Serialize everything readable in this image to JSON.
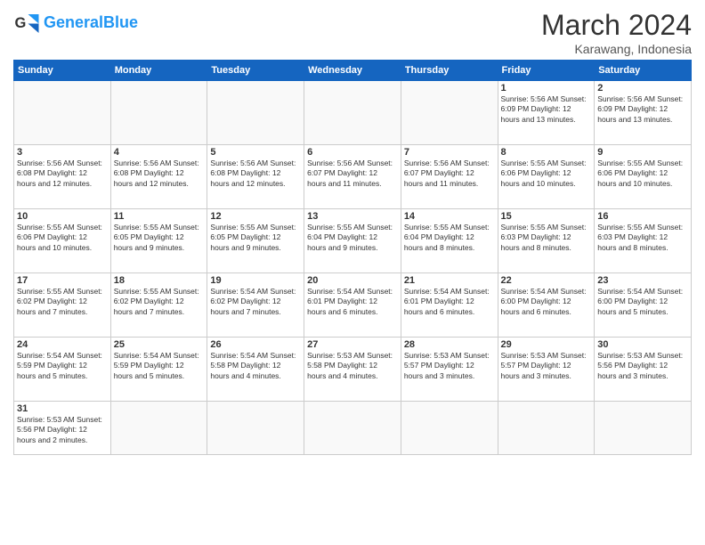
{
  "header": {
    "logo_general": "General",
    "logo_blue": "Blue",
    "title": "March 2024",
    "subtitle": "Karawang, Indonesia"
  },
  "days_of_week": [
    "Sunday",
    "Monday",
    "Tuesday",
    "Wednesday",
    "Thursday",
    "Friday",
    "Saturday"
  ],
  "weeks": [
    [
      {
        "day": "",
        "info": ""
      },
      {
        "day": "",
        "info": ""
      },
      {
        "day": "",
        "info": ""
      },
      {
        "day": "",
        "info": ""
      },
      {
        "day": "",
        "info": ""
      },
      {
        "day": "1",
        "info": "Sunrise: 5:56 AM\nSunset: 6:09 PM\nDaylight: 12 hours\nand 13 minutes."
      },
      {
        "day": "2",
        "info": "Sunrise: 5:56 AM\nSunset: 6:09 PM\nDaylight: 12 hours\nand 13 minutes."
      }
    ],
    [
      {
        "day": "3",
        "info": "Sunrise: 5:56 AM\nSunset: 6:08 PM\nDaylight: 12 hours\nand 12 minutes."
      },
      {
        "day": "4",
        "info": "Sunrise: 5:56 AM\nSunset: 6:08 PM\nDaylight: 12 hours\nand 12 minutes."
      },
      {
        "day": "5",
        "info": "Sunrise: 5:56 AM\nSunset: 6:08 PM\nDaylight: 12 hours\nand 12 minutes."
      },
      {
        "day": "6",
        "info": "Sunrise: 5:56 AM\nSunset: 6:07 PM\nDaylight: 12 hours\nand 11 minutes."
      },
      {
        "day": "7",
        "info": "Sunrise: 5:56 AM\nSunset: 6:07 PM\nDaylight: 12 hours\nand 11 minutes."
      },
      {
        "day": "8",
        "info": "Sunrise: 5:55 AM\nSunset: 6:06 PM\nDaylight: 12 hours\nand 10 minutes."
      },
      {
        "day": "9",
        "info": "Sunrise: 5:55 AM\nSunset: 6:06 PM\nDaylight: 12 hours\nand 10 minutes."
      }
    ],
    [
      {
        "day": "10",
        "info": "Sunrise: 5:55 AM\nSunset: 6:06 PM\nDaylight: 12 hours\nand 10 minutes."
      },
      {
        "day": "11",
        "info": "Sunrise: 5:55 AM\nSunset: 6:05 PM\nDaylight: 12 hours\nand 9 minutes."
      },
      {
        "day": "12",
        "info": "Sunrise: 5:55 AM\nSunset: 6:05 PM\nDaylight: 12 hours\nand 9 minutes."
      },
      {
        "day": "13",
        "info": "Sunrise: 5:55 AM\nSunset: 6:04 PM\nDaylight: 12 hours\nand 9 minutes."
      },
      {
        "day": "14",
        "info": "Sunrise: 5:55 AM\nSunset: 6:04 PM\nDaylight: 12 hours\nand 8 minutes."
      },
      {
        "day": "15",
        "info": "Sunrise: 5:55 AM\nSunset: 6:03 PM\nDaylight: 12 hours\nand 8 minutes."
      },
      {
        "day": "16",
        "info": "Sunrise: 5:55 AM\nSunset: 6:03 PM\nDaylight: 12 hours\nand 8 minutes."
      }
    ],
    [
      {
        "day": "17",
        "info": "Sunrise: 5:55 AM\nSunset: 6:02 PM\nDaylight: 12 hours\nand 7 minutes."
      },
      {
        "day": "18",
        "info": "Sunrise: 5:55 AM\nSunset: 6:02 PM\nDaylight: 12 hours\nand 7 minutes."
      },
      {
        "day": "19",
        "info": "Sunrise: 5:54 AM\nSunset: 6:02 PM\nDaylight: 12 hours\nand 7 minutes."
      },
      {
        "day": "20",
        "info": "Sunrise: 5:54 AM\nSunset: 6:01 PM\nDaylight: 12 hours\nand 6 minutes."
      },
      {
        "day": "21",
        "info": "Sunrise: 5:54 AM\nSunset: 6:01 PM\nDaylight: 12 hours\nand 6 minutes."
      },
      {
        "day": "22",
        "info": "Sunrise: 5:54 AM\nSunset: 6:00 PM\nDaylight: 12 hours\nand 6 minutes."
      },
      {
        "day": "23",
        "info": "Sunrise: 5:54 AM\nSunset: 6:00 PM\nDaylight: 12 hours\nand 5 minutes."
      }
    ],
    [
      {
        "day": "24",
        "info": "Sunrise: 5:54 AM\nSunset: 5:59 PM\nDaylight: 12 hours\nand 5 minutes."
      },
      {
        "day": "25",
        "info": "Sunrise: 5:54 AM\nSunset: 5:59 PM\nDaylight: 12 hours\nand 5 minutes."
      },
      {
        "day": "26",
        "info": "Sunrise: 5:54 AM\nSunset: 5:58 PM\nDaylight: 12 hours\nand 4 minutes."
      },
      {
        "day": "27",
        "info": "Sunrise: 5:53 AM\nSunset: 5:58 PM\nDaylight: 12 hours\nand 4 minutes."
      },
      {
        "day": "28",
        "info": "Sunrise: 5:53 AM\nSunset: 5:57 PM\nDaylight: 12 hours\nand 3 minutes."
      },
      {
        "day": "29",
        "info": "Sunrise: 5:53 AM\nSunset: 5:57 PM\nDaylight: 12 hours\nand 3 minutes."
      },
      {
        "day": "30",
        "info": "Sunrise: 5:53 AM\nSunset: 5:56 PM\nDaylight: 12 hours\nand 3 minutes."
      }
    ],
    [
      {
        "day": "31",
        "info": "Sunrise: 5:53 AM\nSunset: 5:56 PM\nDaylight: 12 hours\nand 2 minutes."
      },
      {
        "day": "",
        "info": ""
      },
      {
        "day": "",
        "info": ""
      },
      {
        "day": "",
        "info": ""
      },
      {
        "day": "",
        "info": ""
      },
      {
        "day": "",
        "info": ""
      },
      {
        "day": "",
        "info": ""
      }
    ]
  ]
}
